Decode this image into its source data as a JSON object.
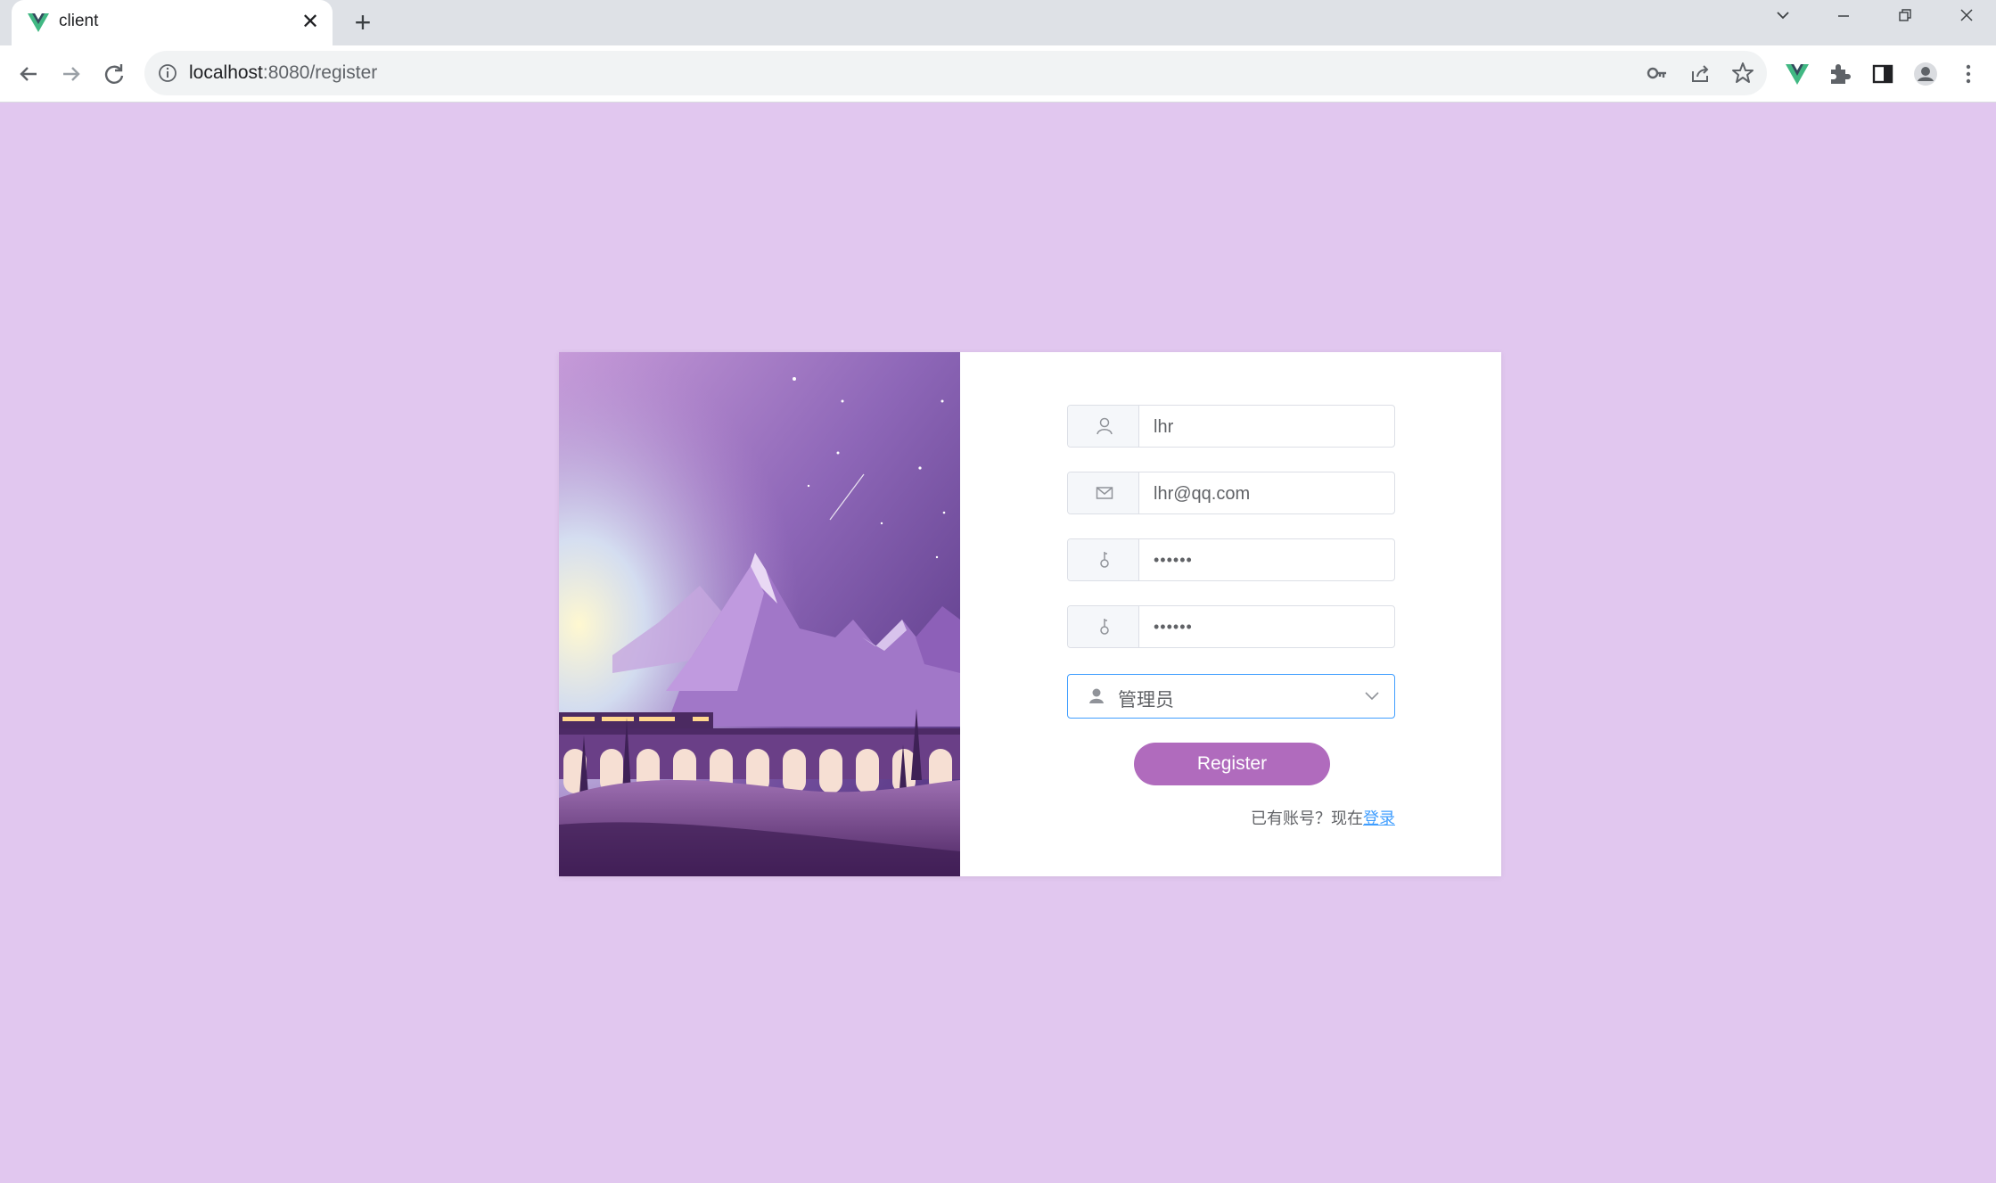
{
  "browser": {
    "tab_title": "client",
    "tab_close_glyph": "✕",
    "new_tab_glyph": "+",
    "url_host": "localhost",
    "url_rest": ":8080/register",
    "icons": [
      "vue-favicon-icon",
      "info-icon",
      "key-icon",
      "share-icon",
      "star-icon",
      "vue-devtools-icon",
      "extensions-icon",
      "side-panel-icon",
      "profile-icon",
      "menu-icon"
    ]
  },
  "form": {
    "username": {
      "value": "lhr",
      "icon": "user-icon"
    },
    "email": {
      "value": "lhr@qq.com",
      "icon": "mail-icon"
    },
    "password": {
      "value": "••••••",
      "icon": "key-icon"
    },
    "confirm_password": {
      "value": "••••••",
      "icon": "key-icon"
    },
    "role": {
      "value": "管理员",
      "icon": "user-filled-icon"
    },
    "register_label": "Register",
    "login_hint": "已有账号？现在",
    "login_link": "登录"
  },
  "colors": {
    "page_background": "#e1c7ef",
    "button": "#b06bbd",
    "link": "#409eff",
    "select_focus_border": "#409eff"
  }
}
